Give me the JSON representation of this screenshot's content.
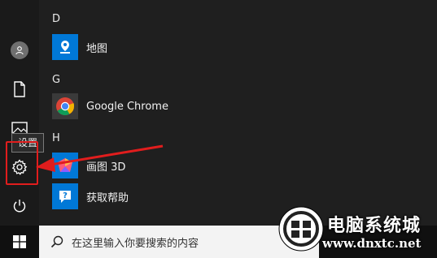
{
  "rail": {
    "items": [
      "user",
      "documents",
      "pictures",
      "settings",
      "power"
    ],
    "tooltip": "设置"
  },
  "app_list": {
    "sections": [
      {
        "letter": "D",
        "apps": [
          {
            "name": "地图",
            "icon": "maps-icon"
          }
        ]
      },
      {
        "letter": "G",
        "apps": [
          {
            "name": "Google Chrome",
            "icon": "chrome-icon"
          }
        ]
      },
      {
        "letter": "H",
        "apps": [
          {
            "name": "画图 3D",
            "icon": "paint-3d-icon"
          },
          {
            "name": "获取帮助",
            "icon": "get-help-icon"
          }
        ]
      }
    ]
  },
  "taskbar": {
    "search_placeholder": "在这里输入你要搜索的内容"
  },
  "watermark": {
    "title": "电脑系统城",
    "url": "www.dnxtc.net"
  },
  "colors": {
    "background": "#1f1f1f",
    "accent": "#0078d7",
    "highlight": "#e11d1d"
  }
}
